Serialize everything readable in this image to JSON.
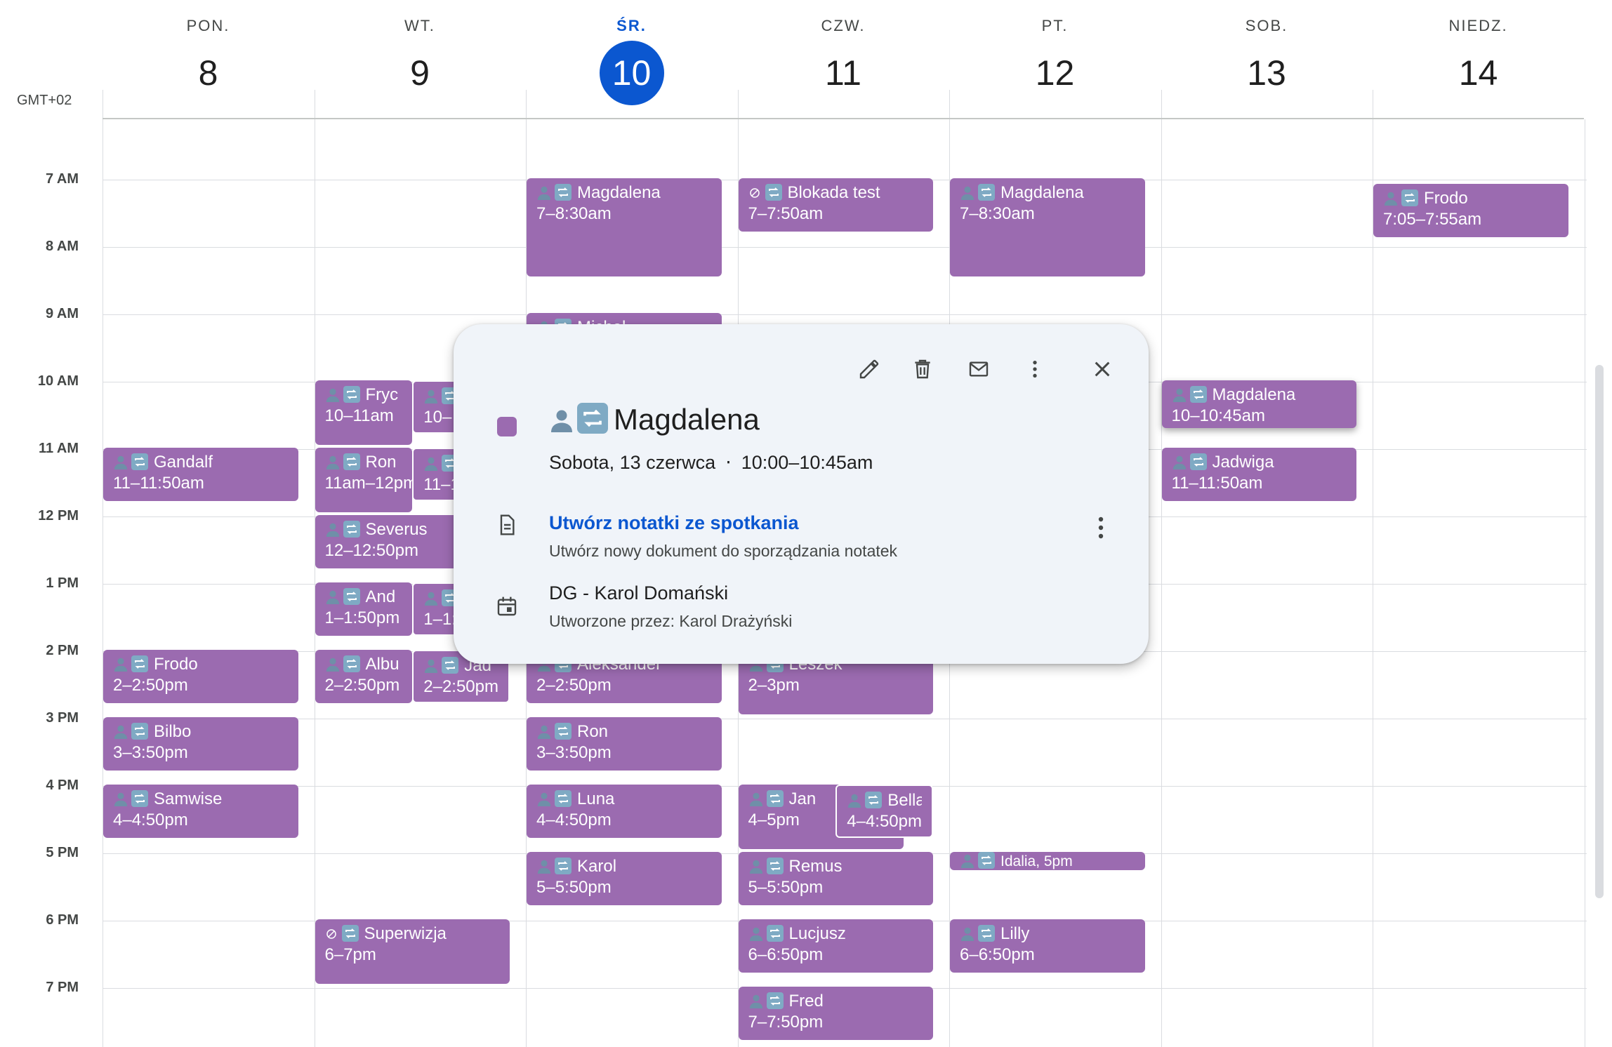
{
  "colors": {
    "event": "#9b6bb0",
    "today": "#0b57d0",
    "link": "#0b57d0",
    "popup_bg": "#f0f4f9"
  },
  "header": {
    "timezone": "GMT+02",
    "days": [
      {
        "name": "PON.",
        "num": "8"
      },
      {
        "name": "WT.",
        "num": "9"
      },
      {
        "name": "ŚR.",
        "num": "10",
        "today": true
      },
      {
        "name": "CZW.",
        "num": "11"
      },
      {
        "name": "PT.",
        "num": "12"
      },
      {
        "name": "SOB.",
        "num": "13"
      },
      {
        "name": "NIEDZ.",
        "num": "14"
      }
    ]
  },
  "hours": [
    "7 AM",
    "8 AM",
    "9 AM",
    "10 AM",
    "11 AM",
    "12 PM",
    "1 PM",
    "2 PM",
    "3 PM",
    "4 PM",
    "5 PM",
    "6 PM",
    "7 PM"
  ],
  "events": [
    {
      "day": 0,
      "start": 11,
      "end": 11.833,
      "title": "Gandalf",
      "time": "11–11:50am",
      "icon": "person"
    },
    {
      "day": 0,
      "start": 14,
      "end": 14.833,
      "title": "Frodo",
      "time": "2–2:50pm",
      "icon": "person"
    },
    {
      "day": 0,
      "start": 15,
      "end": 15.833,
      "title": "Bilbo",
      "time": "3–3:50pm",
      "icon": "person"
    },
    {
      "day": 0,
      "start": 16,
      "end": 16.833,
      "title": "Samwise",
      "time": "4–4:50pm",
      "icon": "person"
    },
    {
      "day": 1,
      "start": 10,
      "end": 11,
      "title": "Fryc",
      "time": "10–11am",
      "icon": "person",
      "w": 0.5
    },
    {
      "day": 1,
      "start": 10,
      "end": 10.833,
      "title": "",
      "time": "10–",
      "icon": "person",
      "w": 0.5,
      "off": 0.5,
      "stack": true
    },
    {
      "day": 1,
      "start": 11,
      "end": 12,
      "title": "Ron",
      "time": "11am–12pm",
      "icon": "person",
      "w": 0.5
    },
    {
      "day": 1,
      "start": 11,
      "end": 11.833,
      "title": "",
      "time": "11–1",
      "icon": "person",
      "w": 0.5,
      "off": 0.5,
      "stack": true
    },
    {
      "day": 1,
      "start": 12,
      "end": 12.833,
      "title": "Severus",
      "time": "12–12:50pm",
      "icon": "person"
    },
    {
      "day": 1,
      "start": 13,
      "end": 13.833,
      "title": "And",
      "time": "1–1:50pm",
      "icon": "person",
      "w": 0.5
    },
    {
      "day": 1,
      "start": 13,
      "end": 13.833,
      "title": "",
      "time": "1–1:5",
      "icon": "person",
      "w": 0.5,
      "off": 0.5,
      "stack": true
    },
    {
      "day": 1,
      "start": 14,
      "end": 14.833,
      "title": "Albu",
      "time": "2–2:50pm",
      "icon": "person",
      "w": 0.5
    },
    {
      "day": 1,
      "start": 14,
      "end": 14.833,
      "title": "Jad",
      "time": "2–2:50pm",
      "icon": "person",
      "w": 0.5,
      "off": 0.5,
      "stack": true
    },
    {
      "day": 1,
      "start": 18,
      "end": 19,
      "title": "Superwizja",
      "time": "6–7pm",
      "icon": "blocked"
    },
    {
      "day": 2,
      "start": 7,
      "end": 8.5,
      "title": "Magdalena",
      "time": "7–8:30am",
      "icon": "person"
    },
    {
      "day": 2,
      "start": 9,
      "end": 9.3,
      "title": "Michal",
      "time": "",
      "icon": "person"
    },
    {
      "day": 2,
      "start": 14,
      "end": 14.833,
      "title": "Aleksander",
      "time": "2–2:50pm",
      "icon": "person"
    },
    {
      "day": 2,
      "start": 15,
      "end": 15.833,
      "title": "Ron",
      "time": "3–3:50pm",
      "icon": "person"
    },
    {
      "day": 2,
      "start": 16,
      "end": 16.833,
      "title": "Luna",
      "time": "4–4:50pm",
      "icon": "person"
    },
    {
      "day": 2,
      "start": 17,
      "end": 17.833,
      "title": "Karol",
      "time": "5–5:50pm",
      "icon": "person"
    },
    {
      "day": 3,
      "start": 7,
      "end": 7.833,
      "title": "Blokada test",
      "time": "7–7:50am",
      "icon": "blocked"
    },
    {
      "day": 3,
      "start": 14,
      "end": 15,
      "title": "Leszek",
      "time": "2–3pm",
      "icon": "person"
    },
    {
      "day": 3,
      "start": 16,
      "end": 17,
      "title": "Jan",
      "time": "4–5pm",
      "icon": "person",
      "w": 0.85
    },
    {
      "day": 3,
      "start": 16,
      "end": 16.833,
      "title": "Bella",
      "time": "4–4:50pm",
      "icon": "person",
      "w": 0.5,
      "off": 0.5,
      "stack": true
    },
    {
      "day": 3,
      "start": 17,
      "end": 17.833,
      "title": "Remus",
      "time": "5–5:50pm",
      "icon": "person"
    },
    {
      "day": 3,
      "start": 18,
      "end": 18.833,
      "title": "Lucjusz",
      "time": "6–6:50pm",
      "icon": "person"
    },
    {
      "day": 3,
      "start": 19,
      "end": 19.833,
      "title": "Fred",
      "time": "7–7:50pm",
      "icon": "person"
    },
    {
      "day": 4,
      "start": 7,
      "end": 8.5,
      "title": "Magdalena",
      "time": "7–8:30am",
      "icon": "person"
    },
    {
      "day": 4,
      "start": 17,
      "end": 17.3,
      "title": "Idalia, 5pm",
      "time": "",
      "icon": "person",
      "small": true
    },
    {
      "day": 4,
      "start": 18,
      "end": 18.833,
      "title": "Lilly",
      "time": "6–6:50pm",
      "icon": "person"
    },
    {
      "day": 5,
      "start": 10,
      "end": 10.75,
      "title": "Magdalena",
      "time": "10–10:45am",
      "icon": "person",
      "selected": true
    },
    {
      "day": 5,
      "start": 11,
      "end": 11.833,
      "title": "Jadwiga",
      "time": "11–11:50am",
      "icon": "person"
    },
    {
      "day": 6,
      "start": 7.083,
      "end": 7.917,
      "title": "Frodo",
      "time": "7:05–7:55am",
      "icon": "person"
    }
  ],
  "popup": {
    "title": "Magdalena",
    "date": "Sobota, 13 czerwca",
    "separator": "⋅",
    "time": "10:00–10:45am",
    "notes_link": "Utwórz notatki ze spotkania",
    "notes_sub": "Utwórz nowy dokument do sporządzania notatek",
    "calendar_name": "DG - Karol Domański",
    "calendar_sub": "Utworzone przez: Karol Drażyński",
    "icons": {
      "edit": "pencil-icon",
      "delete": "trash-icon",
      "email": "mail-icon",
      "more": "more-vert-icon",
      "close": "close-icon"
    }
  }
}
